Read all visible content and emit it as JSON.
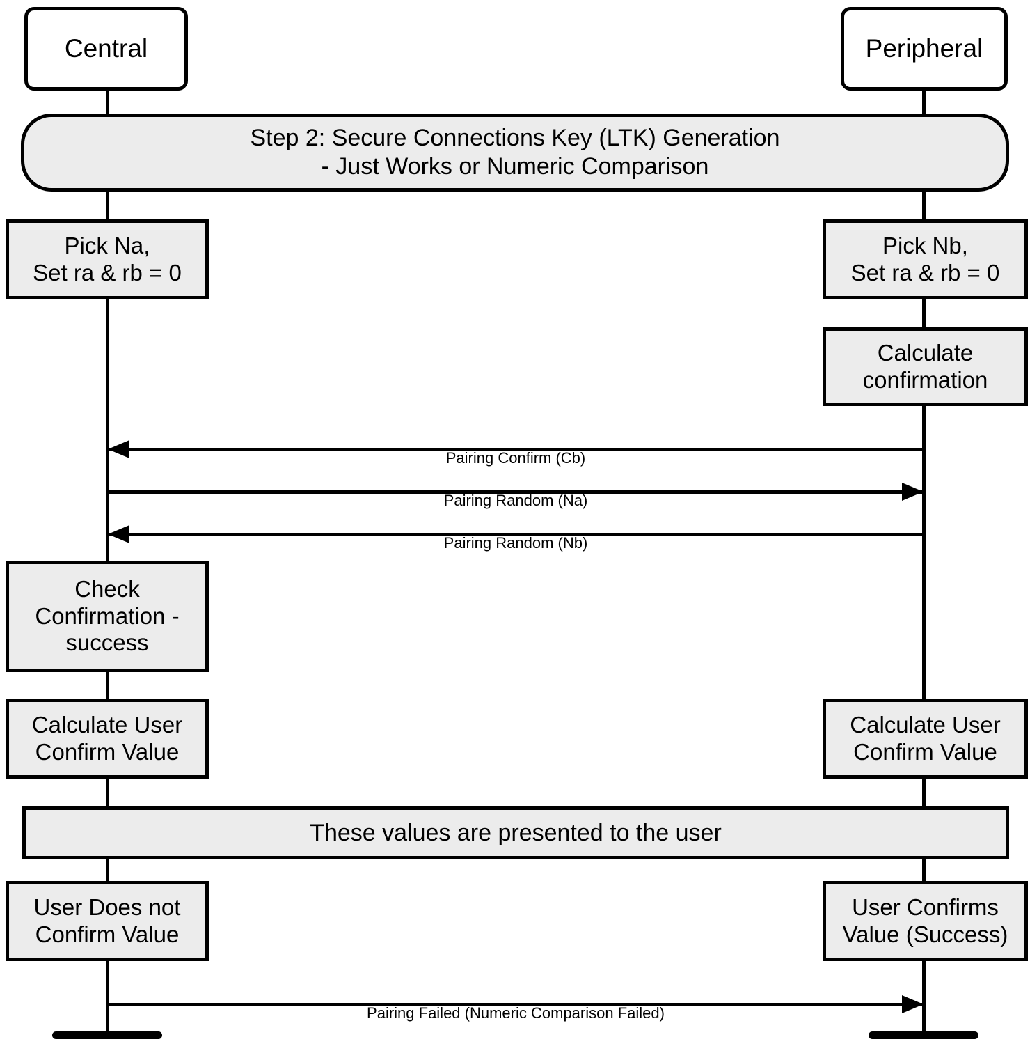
{
  "diagram": {
    "title": "Step 2: Secure Connections Key (LTK) Generation - Just Works or Numeric Comparison",
    "type": "sequence-diagram",
    "colors": {
      "box_fill": "#ececec",
      "stroke": "#000000",
      "background": "#ffffff"
    }
  },
  "actors": [
    {
      "id": "central",
      "label": "Central"
    },
    {
      "id": "peripheral",
      "label": "Peripheral"
    }
  ],
  "banners": [
    {
      "id": "step2-banner",
      "line1": "Step 2: Secure Connections Key (LTK) Generation",
      "line2": "- Just Works or Numeric Comparison",
      "shape": "rounded"
    },
    {
      "id": "presented-banner",
      "line1": "These values are presented to the user",
      "shape": "rectangle"
    }
  ],
  "notes": {
    "pick_na": {
      "line1": "Pick Na,",
      "line2": "Set ra & rb = 0"
    },
    "pick_nb": {
      "line1": "Pick Nb,",
      "line2": "Set ra & rb = 0"
    },
    "calc_confirmation": {
      "line1": "Calculate",
      "line2": "confirmation"
    },
    "check_confirmation": {
      "line1": "Check",
      "line2": "Confirmation -",
      "line3": "success"
    },
    "calc_user_confirm_left": {
      "line1": "Calculate User",
      "line2": "Confirm Value"
    },
    "calc_user_confirm_right": {
      "line1": "Calculate User",
      "line2": "Confirm Value"
    },
    "user_not_confirm": {
      "line1": "User Does not",
      "line2": "Confirm Value"
    },
    "user_confirms": {
      "line1": "User Confirms",
      "line2": "Value (Success)"
    }
  },
  "messages": [
    {
      "id": "msg-pairing-confirm-cb",
      "label": "Pairing Confirm (Cb)",
      "direction": "right-to-left",
      "from": "peripheral",
      "to": "central"
    },
    {
      "id": "msg-pairing-random-na",
      "label": "Pairing Random (Na)",
      "direction": "left-to-right",
      "from": "central",
      "to": "peripheral"
    },
    {
      "id": "msg-pairing-random-nb",
      "label": "Pairing Random (Nb)",
      "direction": "right-to-left",
      "from": "peripheral",
      "to": "central"
    },
    {
      "id": "msg-pairing-failed",
      "label": "Pairing Failed (Numeric Comparison Failed)",
      "direction": "left-to-right",
      "from": "central",
      "to": "peripheral"
    }
  ]
}
